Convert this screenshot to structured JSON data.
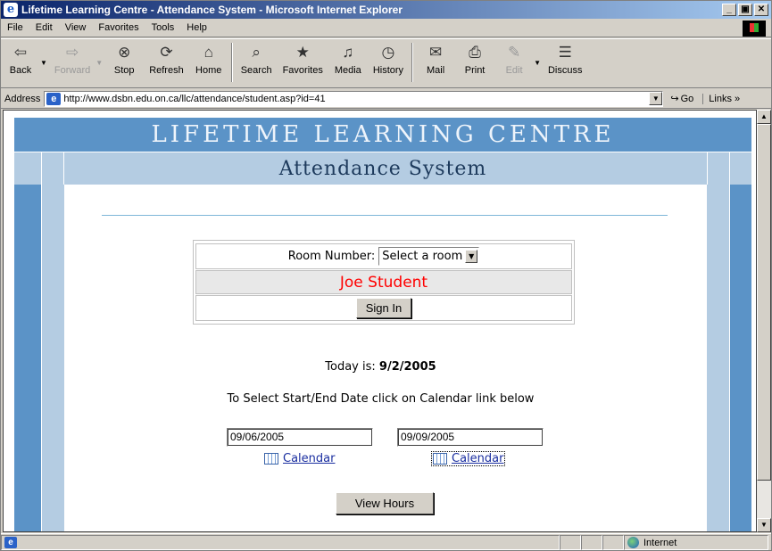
{
  "window": {
    "title": "Lifetime Learning Centre - Attendance System - Microsoft Internet Explorer",
    "controls": [
      "_",
      "▣",
      "✕"
    ]
  },
  "menu": [
    "File",
    "Edit",
    "View",
    "Favorites",
    "Tools",
    "Help"
  ],
  "toolbar": {
    "back": "Back",
    "forward": "Forward",
    "stop": "Stop",
    "refresh": "Refresh",
    "home": "Home",
    "search": "Search",
    "favorites": "Favorites",
    "media": "Media",
    "history": "History",
    "mail": "Mail",
    "print": "Print",
    "edit": "Edit",
    "discuss": "Discuss"
  },
  "address": {
    "label": "Address",
    "url": "http://www.dsbn.edu.on.ca/llc/attendance/student.asp?id=41",
    "go": "Go",
    "links": "Links »"
  },
  "page": {
    "header_title": "LIFETIME LEARNING CENTRE",
    "header_subtitle": "Attendance System",
    "room_label": "Room Number:",
    "room_select": "Select a room",
    "student_name": "Joe Student",
    "sign_in": "Sign In",
    "today_label": "Today is:",
    "today_date": "9/2/2005",
    "instructions": "To Select Start/End Date click on Calendar link below",
    "start_date": "09/06/2005",
    "end_date": "09/09/2005",
    "calendar_link": "Calendar",
    "view_hours": "View Hours"
  },
  "status": {
    "zone": "Internet"
  },
  "colors": {
    "band_dark": "#5b93c7",
    "band_light": "#b4cce2",
    "student_name": "#ff0000",
    "link": "#1a2ea0"
  }
}
